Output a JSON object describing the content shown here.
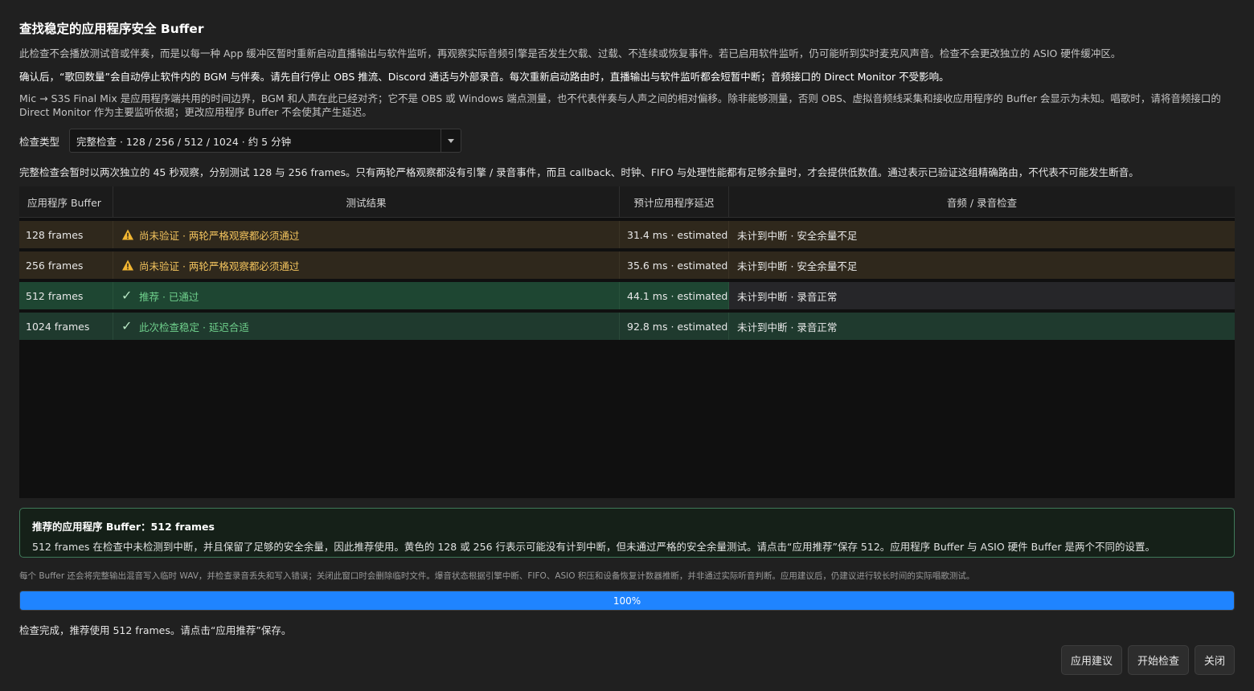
{
  "dialog": {
    "title": "查找稳定的应用程序安全 Buffer",
    "intro": "此检查不会播放测试音或伴奏，而是以每一种 App 缓冲区暂时重新启动直播输出与软件监听，再观察实际音频引擎是否发生欠载、过载、不连续或恢复事件。若已启用软件监听，仍可能听到实时麦克风声音。检查不会更改独立的 ASIO 硬件缓冲区。",
    "confirm": "确认后，“歌回数量”会自动停止软件内的 BGM 与伴奏。请先自行停止 OBS 推流、Discord 通话与外部录音。每次重新启动路由时，直播输出与软件监听都会短暂中断；音频接口的 Direct Monitor 不受影响。",
    "latency_note": "Mic → S3S Final Mix 是应用程序端共用的时间边界，BGM 和人声在此已经对齐；它不是 OBS 或 Windows 端点测量，也不代表伴奏与人声之间的相对偏移。除非能够测量，否则 OBS、虚拟音频线采集和接收应用程序的 Buffer 会显示为未知。唱歌时，请将音频接口的 Direct Monitor 作为主要监听依据；更改应用程序 Buffer 不会使其产生延迟。"
  },
  "check_type": {
    "label": "检查类型",
    "selected": "完整检查 · 128 / 256 / 512 / 1024 · 约 5 分钟"
  },
  "full_check_desc": "完整检查会暂时以两次独立的 45 秒观察，分别测试 128 与 256 frames。只有两轮严格观察都没有引擎 / 录音事件，而且 callback、时钟、FIFO 与处理性能都有足够余量时，才会提供低数值。通过表示已验证这组精确路由，不代表不可能发生断音。",
  "table": {
    "headers": [
      "应用程序 Buffer",
      "测试结果",
      "预计应用程序延迟",
      "音频 / 录音检查"
    ],
    "rows": [
      {
        "buffer": "128 frames",
        "result": "尚未验证 · 两轮严格观察都必须通过",
        "latency": "31.4 ms · estimated",
        "audio": "未计到中断 · 安全余量不足",
        "state": "warn"
      },
      {
        "buffer": "256 frames",
        "result": "尚未验证 · 两轮严格观察都必须通过",
        "latency": "35.6 ms · estimated",
        "audio": "未计到中断 · 安全余量不足",
        "state": "warn"
      },
      {
        "buffer": "512 frames",
        "result": "推荐 · 已通过",
        "latency": "44.1 ms · estimated",
        "audio": "未计到中断 · 录音正常",
        "state": "ok"
      },
      {
        "buffer": "1024 frames",
        "result": "此次检查稳定 · 延迟合适",
        "latency": "92.8 ms · estimated",
        "audio": "未计到中断 · 录音正常",
        "state": "ok2"
      }
    ]
  },
  "recommendation": {
    "title": "推荐的应用程序 Buffer：512 frames",
    "body": "512 frames 在检查中未检测到中断，并且保留了足够的安全余量，因此推荐使用。黄色的 128 或 256 行表示可能没有计到中断，但未通过严格的安全余量测试。请点击“应用推荐”保存 512。应用程序 Buffer 与 ASIO 硬件 Buffer 是两个不同的设置。"
  },
  "footnote": "每个 Buffer 还会将完整输出混音写入临时 WAV，并检查录音丢失和写入错误；关闭此窗口时会删除临时文件。爆音状态根据引擎中断、FIFO、ASIO 积压和设备恢复计数器推断，并非通过实际听音判断。应用建议后，仍建议进行较长时间的实际唱歌测试。",
  "progress": {
    "value": 1.0,
    "label": "100%"
  },
  "status": "检查完成，推荐使用 512 frames。请点击“应用推荐”保存。",
  "buttons": {
    "apply": "应用建议",
    "start": "开始检查",
    "close": "关闭"
  },
  "colors": {
    "accent": "#1f84ff",
    "warn": "#f2c35e",
    "ok": "#6fd08c"
  }
}
